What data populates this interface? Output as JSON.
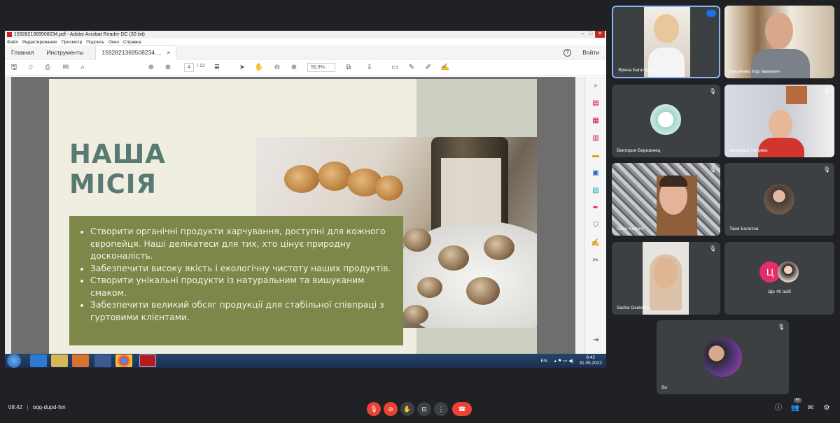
{
  "acrobat": {
    "window_title": "1592821369508234.pdf - Adobe Acrobat Reader DC (32-bit)",
    "menu": [
      "Файл",
      "Редактирование",
      "Просмотр",
      "Подпись",
      "Окно",
      "Справка"
    ],
    "tabs": {
      "home": "Главная",
      "tools": "Инструменты",
      "doc": "1592821369508234....",
      "close": "×"
    },
    "help": "?",
    "signin": "Войти",
    "page_current": "4",
    "page_total": "/ 12",
    "zoom": "56,9%"
  },
  "slide": {
    "title_line1": "НАША",
    "title_line2": "МІСІЯ",
    "bullets": [
      "Створити органічні продукти харчування, доступні для кожного європейця. Наші делікатеси для тих, хто цінує природну досконалість.",
      "Забезпечити високу якість і екологічну чистоту наших продуктів.",
      "Створити унікальні продукти із натуральним та вишуканим смаком.",
      "Забезпечити великий обсяг продукції для стабільної співпраці з гуртовими клієнтами."
    ],
    "colors": {
      "title": "#597a72",
      "bullet_box": "#7d874a",
      "background": "#efeee0",
      "sage": "#cbd0c2"
    }
  },
  "taskbar": {
    "lang": "EN",
    "time": "8:42",
    "date": "31.05.2022"
  },
  "participants": [
    {
      "name": "Ярина Багатирова"
    },
    {
      "name": "Кукуненко Ігор Іванович"
    },
    {
      "name": "Виктория Березинец"
    },
    {
      "name": "Катерина Петряко"
    },
    {
      "name": "Stefa Kushnir"
    },
    {
      "name": "Таня Болотна"
    },
    {
      "name": "Sasha Oseledec"
    },
    {
      "name": "Ще 40 осіб",
      "initial": "Ц"
    },
    {
      "name": "Ви"
    }
  ],
  "meeting": {
    "time": "08:42",
    "separator": "|",
    "code": "oqq-dupd-fxn",
    "people_count": "47"
  }
}
